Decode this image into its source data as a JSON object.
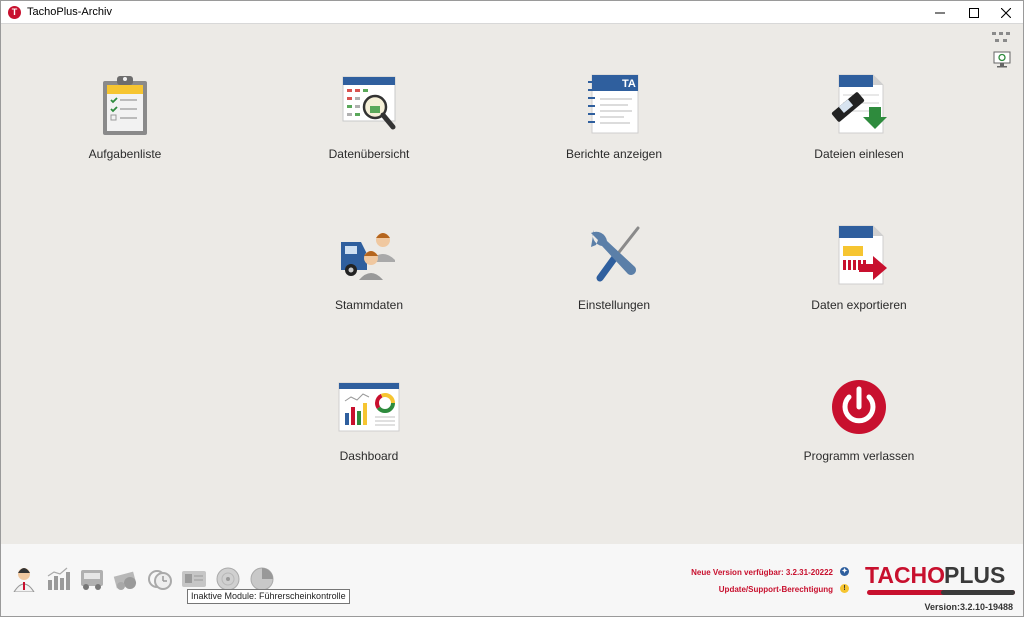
{
  "window": {
    "title": "TachoPlus-Archiv"
  },
  "tiles": {
    "aufgabenliste": "Aufgabenliste",
    "datenuebersicht": "Datenübersicht",
    "berichte": "Berichte anzeigen",
    "dateien_einlesen": "Dateien einlesen",
    "stammdaten": "Stammdaten",
    "einstellungen": "Einstellungen",
    "daten_exportieren": "Daten exportieren",
    "dashboard": "Dashboard",
    "programm_verlassen": "Programm verlassen"
  },
  "bottom": {
    "tooltip": "Inaktive Module: Führerscheinkontrolle",
    "new_version": "Neue Version verfügbar: 3.2.31-20222",
    "support": "Update/Support-Berechtigung",
    "version": "Version:3.2.10-19488",
    "logo_part1": "TACHO",
    "logo_part2": "PLUS"
  },
  "colors": {
    "brand_red": "#c8102e",
    "background": "#eceae6",
    "accent_blue": "#2f5f9e"
  },
  "icons": {
    "tile_icons": [
      "clipboard-checklist-icon",
      "calendar-magnifier-icon",
      "report-notebook-icon",
      "file-import-icon",
      "truck-people-icon",
      "tools-icon",
      "file-export-icon",
      "dashboard-chart-icon",
      "power-icon"
    ],
    "module_icons": [
      "driver-icon",
      "statistics-icon",
      "truck-icon",
      "money-icon",
      "clock-icon",
      "license-card-icon",
      "disc-icon",
      "pie-chart-icon"
    ]
  }
}
